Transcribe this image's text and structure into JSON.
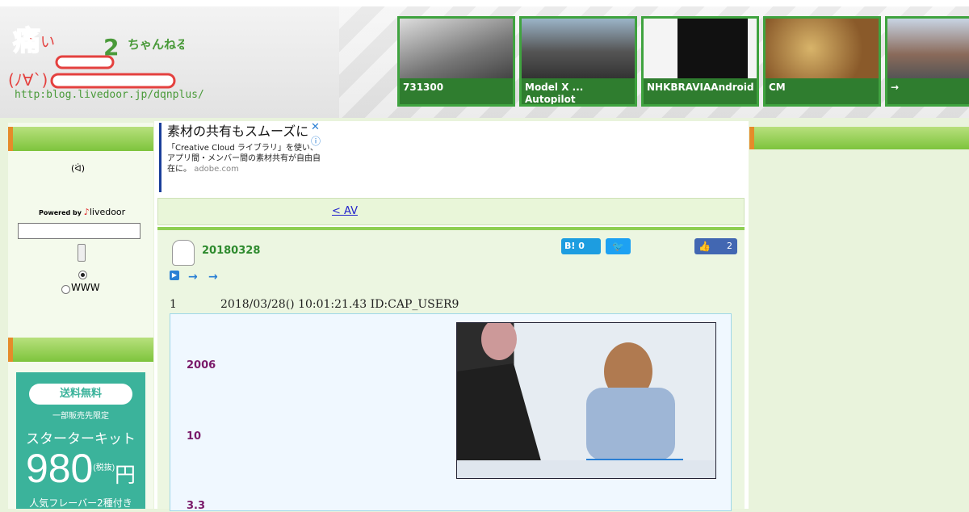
{
  "logo": {
    "url_text": "http:blog.livedoor.jp/dqnplus/"
  },
  "thumbnails": [
    {
      "caption": "731300",
      "bg": "#8a8a8a"
    },
    {
      "caption": "Model X ... Autopilot",
      "bg": "#6d7a84"
    },
    {
      "caption": "NHKBRAVIAAndroid",
      "bg": "#e8e8e8"
    },
    {
      "caption": "CM",
      "bg": "#a07a3a"
    },
    {
      "caption": "→",
      "bg": "#9a7a6a"
    }
  ],
  "sidebar": {
    "powered_by": "Powered by",
    "brand": "livedoor",
    "radio_www": "WWW"
  },
  "promo": {
    "pill": "送料無料",
    "limited": "一部販売先限定",
    "kit": "スターターキット",
    "price": "980",
    "tax": "(税抜)",
    "yen": "円",
    "flavor": "人気フレーバー2種付き"
  },
  "ad": {
    "headline": "素材の共有もスムーズに",
    "body": "「Creative Cloud ライブラリ」を使い、アプリ間・メンバー間の素材共有が自由自在に。",
    "domain": "adobe.com",
    "close": "✕",
    "info": "ⓘ"
  },
  "nav": {
    "link": "<  AV"
  },
  "article": {
    "title": "20180328",
    "hatena_label": "B!",
    "hatena_count": "0",
    "fb_count": "2",
    "arrow1": "→",
    "arrow2": "→",
    "res_number": "1",
    "res_date": "2018/03/28() 10:01:21.43 ID:CAP_USER9",
    "numbers": [
      "2006",
      "10",
      "3.3"
    ]
  },
  "colors": {
    "accent_green": "#7dc43c",
    "article_title": "#2d8a2d",
    "number_purple": "#7a1a6a"
  }
}
